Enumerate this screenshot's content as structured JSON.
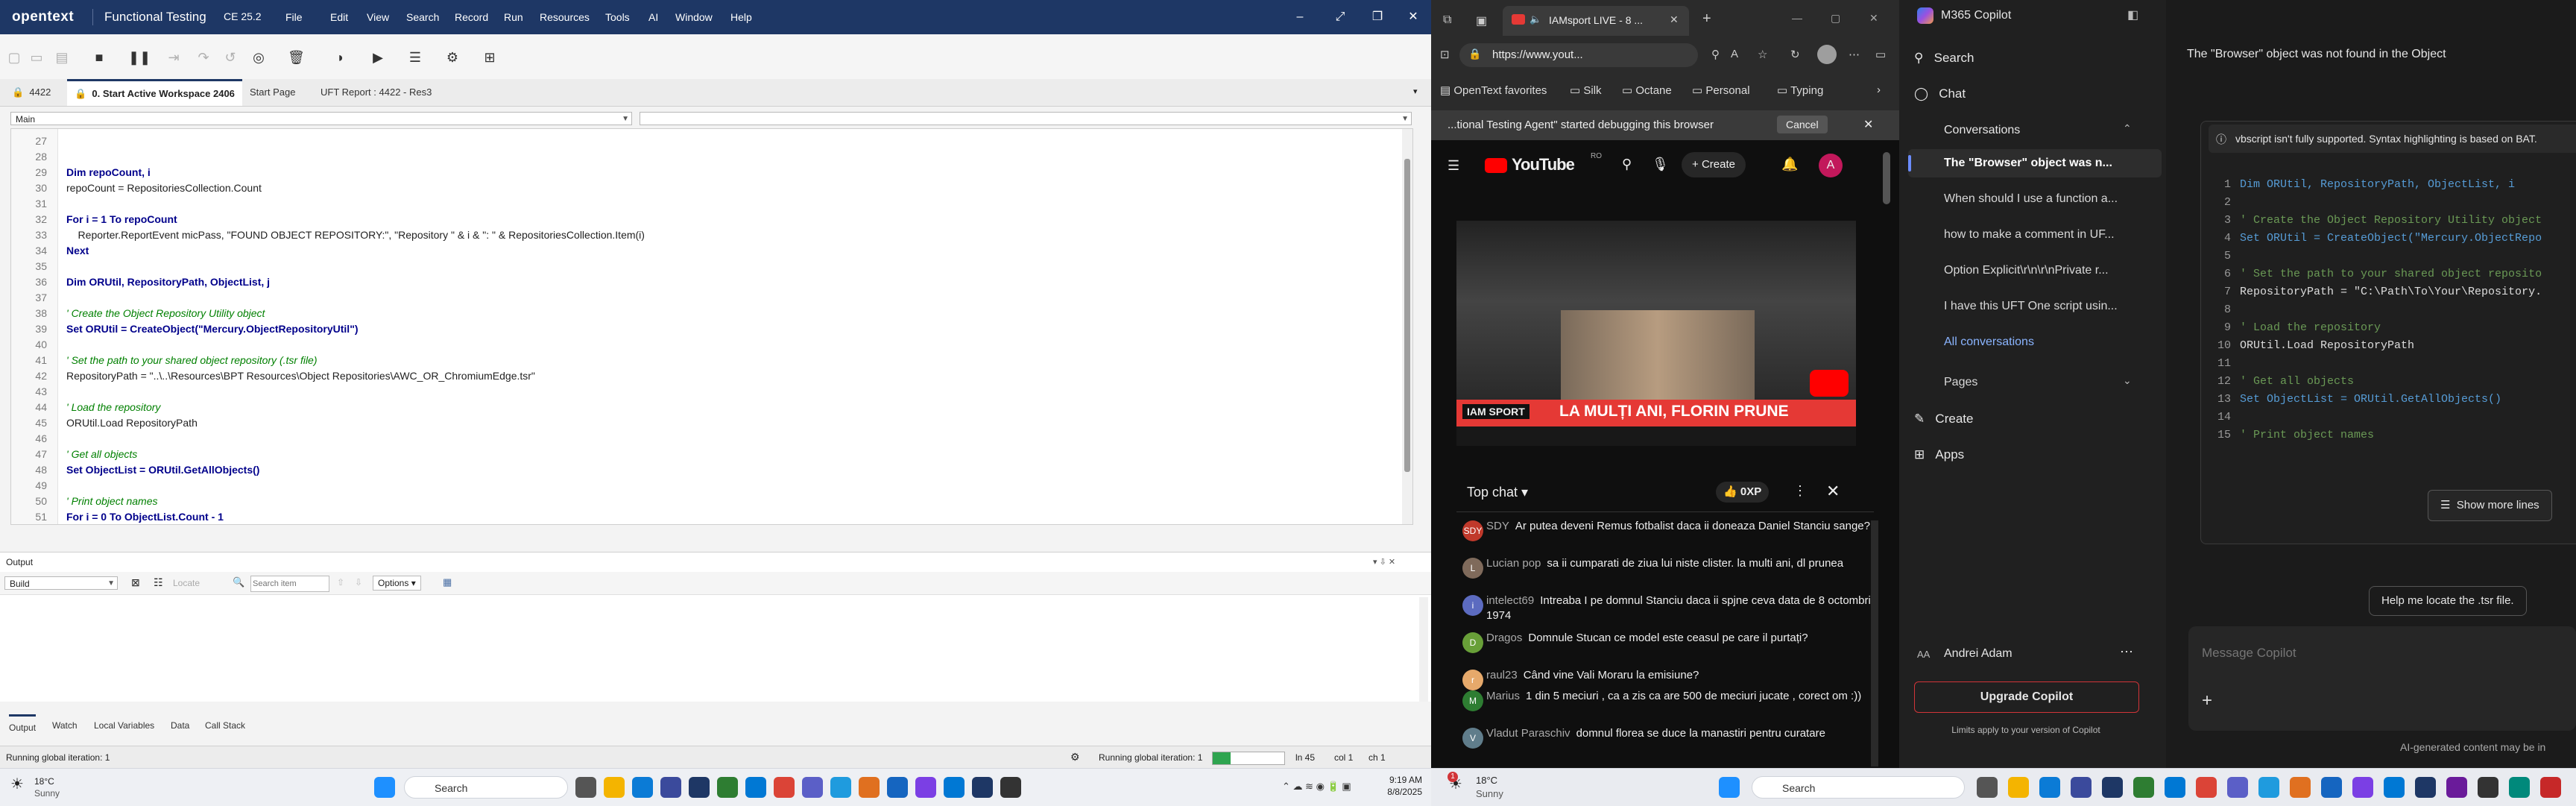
{
  "uft": {
    "logo": "opentext",
    "title": "Functional Testing",
    "version": "CE 25.2",
    "menu": [
      "File",
      "Edit",
      "View",
      "Search",
      "Record",
      "Run",
      "Resources",
      "Tools",
      "AI",
      "Window",
      "Help"
    ],
    "tabs": {
      "id": "4422",
      "workspace": "0. Start Active Workspace 2406",
      "start": "Start Page",
      "report": "UFT Report : 4422 - Res3"
    },
    "combo_main": "Main",
    "code": [
      {
        "n": "27",
        "t": ""
      },
      {
        "n": "28",
        "t": ""
      },
      {
        "n": "29",
        "t": "Dim repoCount, i"
      },
      {
        "n": "30",
        "t": "repoCount = RepositoriesCollection.Count"
      },
      {
        "n": "31",
        "t": ""
      },
      {
        "n": "32",
        "t": "For i = 1 To repoCount"
      },
      {
        "n": "33",
        "t": "    Reporter.ReportEvent micPass, \"FOUND OBJECT REPOSITORY:\", \"Repository \" & i & \": \" & RepositoriesCollection.Item(i)"
      },
      {
        "n": "34",
        "t": "Next"
      },
      {
        "n": "35",
        "t": ""
      },
      {
        "n": "36",
        "t": "Dim ORUtil, RepositoryPath, ObjectList, j"
      },
      {
        "n": "37",
        "t": ""
      },
      {
        "n": "38",
        "t": "' Create the Object Repository Utility object"
      },
      {
        "n": "39",
        "t": "Set ORUtil = CreateObject(\"Mercury.ObjectRepositoryUtil\")"
      },
      {
        "n": "40",
        "t": ""
      },
      {
        "n": "41",
        "t": "' Set the path to your shared object repository (.tsr file)"
      },
      {
        "n": "42",
        "t": "RepositoryPath = \"..\\..\\Resources\\BPT Resources\\Object Repositories\\AWC_OR_ChromiumEdge.tsr\""
      },
      {
        "n": "43",
        "t": ""
      },
      {
        "n": "44",
        "t": "' Load the repository"
      },
      {
        "n": "45",
        "t": "ORUtil.Load RepositoryPath"
      },
      {
        "n": "46",
        "t": ""
      },
      {
        "n": "47",
        "t": "' Get all objects"
      },
      {
        "n": "48",
        "t": "Set ObjectList = ORUtil.GetAllObjects()"
      },
      {
        "n": "49",
        "t": ""
      },
      {
        "n": "50",
        "t": "' Print object names"
      },
      {
        "n": "51",
        "t": "For i = 0 To ObjectList.Count - 1"
      }
    ],
    "output": {
      "title": "Output",
      "filter": "Build",
      "locate": "Locate",
      "search_placeholder": "Search item",
      "options": "Options"
    },
    "bottom_tabs": [
      "Output",
      "Watch",
      "Local Variables",
      "Data",
      "Call Stack"
    ],
    "status": {
      "left": "Running global iteration: 1",
      "center": "Running global iteration: 1",
      "ln": "ln 45",
      "col": "col 1",
      "ch": "ch 1"
    }
  },
  "taskbar_left": {
    "weather_temp": "18°C",
    "weather_cond": "Sunny",
    "search": "Search",
    "time": "9:19 AM",
    "date": "8/8/2025"
  },
  "edge": {
    "tab_title": "IAMsport LIVE - 8 ...",
    "url": "https://www.yout...",
    "favorites": [
      "OpenText favorites",
      "Silk",
      "Octane",
      "Personal",
      "Typing"
    ],
    "debug_banner": "...tional Testing Agent\" started debugging this browser",
    "cancel": "Cancel",
    "youtube_logo": "YouTube",
    "youtube_region": "RO",
    "create": "Create",
    "avatar": "A",
    "video_banner": "LA MULȚI ANI, FLORIN PRUNE",
    "video_badge": "IAM SPORT",
    "chat_title": "Top chat",
    "xp": "0XP",
    "chat": [
      {
        "author": "SDY",
        "msg": "Ar putea deveni Remus fotbalist daca ii doneaza Daniel Stanciu sange?",
        "color": "#c0392b",
        "initial": "SDY"
      },
      {
        "author": "Lucian pop",
        "msg": "sa ii cumparati de ziua lui niste clister. la multi ani, dl prunea",
        "color": "#7f6a5b",
        "initial": "L"
      },
      {
        "author": "intelect69",
        "msg": "Intreaba I pe domnul Stanciu daca ii spjne ceva data de 8 octombrie 1974",
        "color": "#5c6bc0",
        "initial": "i"
      },
      {
        "author": "Dragos",
        "msg": "Domnule Stucan ce model este ceasul pe care il purtați?",
        "color": "#689f38",
        "initial": "D"
      },
      {
        "author": "raul23",
        "msg": "Când vine Vali Moraru la emisiune?",
        "color": "#e6a96b",
        "initial": "r"
      },
      {
        "author": "Marius",
        "msg": "1 din 5 meciuri , ca a zis ca are 500 de meciuri jucate , corect om :))",
        "color": "#2e7d32",
        "initial": "M"
      },
      {
        "author": "Vladut Paraschiv",
        "msg": "domnul florea se duce la manastiri pentru curatare",
        "color": "#607d8b",
        "initial": "V"
      }
    ]
  },
  "taskbar_right": {
    "weather_temp": "18°C",
    "weather_cond": "Sunny",
    "search": "Search",
    "badge": "1"
  },
  "copilot": {
    "title": "M365 Copilot",
    "search": "Search",
    "chat": "Chat",
    "conversations": "Conversations",
    "conversation_items": [
      "The \"Browser\" object was n...",
      "When should I use a function a...",
      "how to make a comment in UF...",
      "Option Explicit\\r\\n\\r\\nPrivate r...",
      "I have this UFT One script usin..."
    ],
    "all_conversations": "All conversations",
    "pages": "Pages",
    "create": "Create",
    "apps": "Apps",
    "user_initials": "AA",
    "user_name": "Andrei Adam",
    "upgrade": "Upgrade Copilot",
    "limits": "Limits apply to your version of Copilot",
    "heading": "The \"Browser\" object was not found in the Object",
    "warning": "vbscript isn't fully supported. Syntax highlighting is based on BAT.",
    "code": [
      {
        "n": "1",
        "t": "Dim ORUtil, RepositoryPath, ObjectList, i"
      },
      {
        "n": "2",
        "t": ""
      },
      {
        "n": "3",
        "t": "' Create the Object Repository Utility object"
      },
      {
        "n": "4",
        "t": "Set ORUtil = CreateObject(\"Mercury.ObjectRepo"
      },
      {
        "n": "5",
        "t": ""
      },
      {
        "n": "6",
        "t": "' Set the path to your shared object reposito"
      },
      {
        "n": "7",
        "t": "RepositoryPath = \"C:\\Path\\To\\Your\\Repository."
      },
      {
        "n": "8",
        "t": ""
      },
      {
        "n": "9",
        "t": "' Load the repository"
      },
      {
        "n": "10",
        "t": "ORUtil.Load RepositoryPath"
      },
      {
        "n": "11",
        "t": ""
      },
      {
        "n": "12",
        "t": "' Get all objects"
      },
      {
        "n": "13",
        "t": "Set ObjectList = ORUtil.GetAllObjects()"
      },
      {
        "n": "14",
        "t": ""
      },
      {
        "n": "15",
        "t": "' Print object names"
      }
    ],
    "show_more": "Show more lines",
    "suggestion": "Help me locate the .tsr file.",
    "message_placeholder": "Message Copilot",
    "disclaimer": "AI-generated content may be in"
  },
  "colors": {
    "uft_title": "#1e3765",
    "progress_green": "#2ea44f",
    "youtube_red": "#ff0000",
    "upgrade_border": "#d13438"
  },
  "progress_fraction": 0.25
}
